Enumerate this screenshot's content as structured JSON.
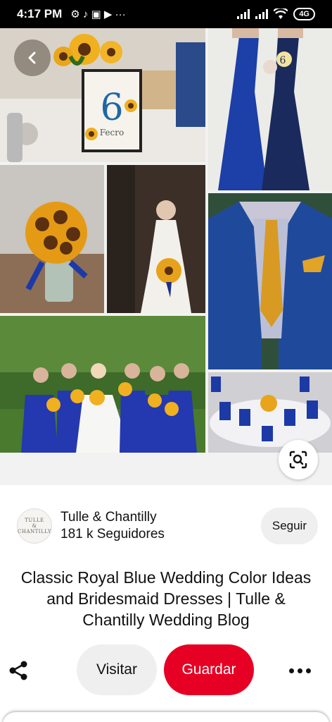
{
  "status_bar": {
    "time": "4:17 PM",
    "left_icons": "⚙ ♪ ▣ ▶ ···",
    "network": "4G"
  },
  "pin": {
    "title": "Classic Royal Blue Wedding Color Ideas and Bridesmaid Dresses | Tulle & Chantilly Wedding Blog",
    "swatch_colors": [
      "#0e2a80",
      "#c07a22",
      "#305a14",
      "#1e3a6e"
    ]
  },
  "profile": {
    "avatar_line1": "TULLE",
    "avatar_line2": "&",
    "avatar_line3": "CHANTILLY",
    "name": "Tulle & Chantilly",
    "followers": "181 k Seguidores",
    "follow_label": "Seguir"
  },
  "actions": {
    "visit_label": "Visitar",
    "save_label": "Guardar"
  },
  "collage": {
    "table_number": "6",
    "table_number_caption": "Fecro",
    "bouquet_tag": "6"
  }
}
